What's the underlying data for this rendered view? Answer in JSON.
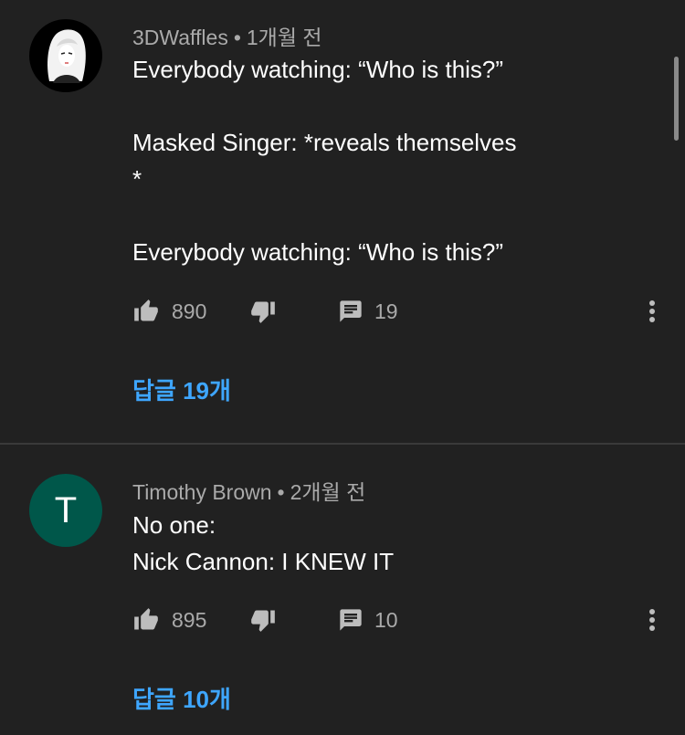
{
  "comments": [
    {
      "author": "3DWaffles",
      "time": "1개월 전",
      "lines": [
        "Everybody watching: “Who is this?”",
        "",
        "Masked Singer: *reveals themselves",
        "*",
        "",
        "Everybody watching: “Who is this?”"
      ],
      "likes": "890",
      "reply_count": "19",
      "replies_label": "답글 19개",
      "avatar_icon": "anime-girl-avatar"
    },
    {
      "author": "Timothy Brown",
      "time": "2개월 전",
      "lines": [
        "No one:",
        "Nick Cannon: I KNEW IT"
      ],
      "likes": "895",
      "reply_count": "10",
      "replies_label": "답글 10개",
      "avatar_letter": "T",
      "avatar_color": "#00574a"
    }
  ],
  "separator": "•",
  "icons": [
    "thumbs-up-icon",
    "thumbs-down-icon",
    "comment-icon",
    "more-vert-icon"
  ],
  "colors": {
    "background": "#212121",
    "text": "#ffffff",
    "secondary": "#aaaaaa",
    "link": "#3ea6ff"
  }
}
